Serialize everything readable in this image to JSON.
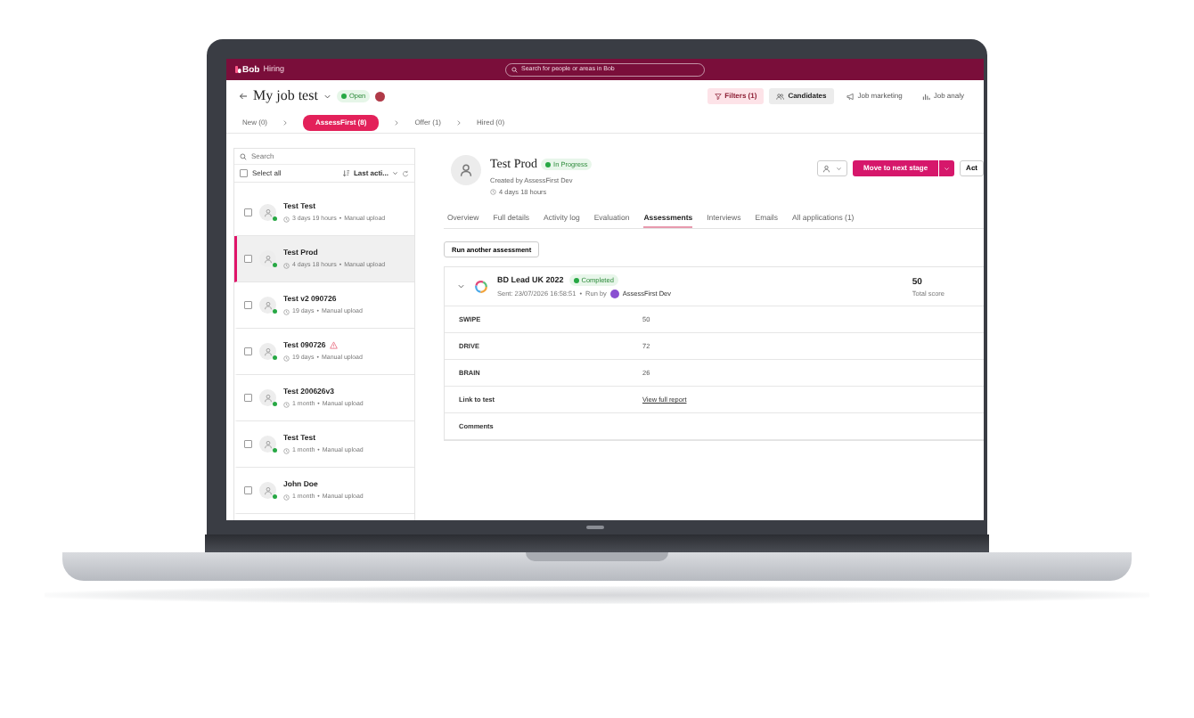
{
  "app": {
    "logo": "Bob",
    "section": "Hiring",
    "search_placeholder": "Search for people or areas in Bob"
  },
  "job": {
    "title": "My job test",
    "status": "Open"
  },
  "filters_button": "Filters (1)",
  "view_tabs": [
    {
      "label": "Candidates",
      "selected": true
    },
    {
      "label": "Job marketing",
      "selected": false
    },
    {
      "label": "Job analy",
      "selected": false
    }
  ],
  "stages": [
    {
      "label": "New (0)",
      "selected": false
    },
    {
      "label": "AssessFirst (8)",
      "selected": true
    },
    {
      "label": "Offer (1)",
      "selected": false
    },
    {
      "label": "Hired (0)",
      "selected": false
    }
  ],
  "candidate_list": {
    "search_placeholder": "Search",
    "select_all": {
      "label": "Select all",
      "checked": false
    },
    "sort": "Last acti...",
    "candidates": [
      {
        "name": "Test Test",
        "time": "3 days 19 hours",
        "separator": "•",
        "source": "Manual upload",
        "selected": false,
        "checked": false,
        "warning": false
      },
      {
        "name": "Test Prod",
        "time": "4 days 18 hours",
        "separator": "•",
        "source": "Manual upload",
        "selected": true,
        "checked": false,
        "warning": false
      },
      {
        "name": "Test v2 090726",
        "time": "19 days",
        "separator": "•",
        "source": "Manual upload",
        "selected": false,
        "checked": false,
        "warning": false
      },
      {
        "name": "Test 090726",
        "time": "19 days",
        "separator": "•",
        "source": "Manual upload",
        "selected": false,
        "checked": false,
        "warning": true
      },
      {
        "name": "Test 200626v3",
        "time": "1 month",
        "separator": "•",
        "source": "Manual upload",
        "selected": false,
        "checked": false,
        "warning": false
      },
      {
        "name": "Test Test",
        "time": "1 month",
        "separator": "•",
        "source": "Manual upload",
        "selected": false,
        "checked": false,
        "warning": false
      },
      {
        "name": "John Doe",
        "time": "1 month",
        "separator": "•",
        "source": "Manual upload",
        "selected": false,
        "checked": false,
        "warning": false
      }
    ]
  },
  "candidate": {
    "name": "Test Prod",
    "status": "In Progress",
    "created": "Created by AssessFirst Dev",
    "time": "4 days 18 hours",
    "primary_button": "Move to next stage",
    "secondary_button": "Act"
  },
  "tabs": [
    {
      "label": "Overview",
      "selected": false
    },
    {
      "label": "Full details",
      "selected": false
    },
    {
      "label": "Activity log",
      "selected": false
    },
    {
      "label": "Evaluation",
      "selected": false
    },
    {
      "label": "Assessments",
      "selected": true
    },
    {
      "label": "Interviews",
      "selected": false
    },
    {
      "label": "Emails",
      "selected": false
    },
    {
      "label": "All applications (1)",
      "selected": false
    }
  ],
  "run_button": "Run another assessment",
  "assessment": {
    "title": "BD Lead UK 2022",
    "status": "Completed",
    "sent": "Sent: 23/07/2026 16:58:51",
    "separator": "•",
    "run_by": "Run by",
    "runner": "AssessFirst Dev",
    "score": "50",
    "score_label": "Total score",
    "rows": [
      {
        "label": "SWIPE",
        "value": "50",
        "kind": "text"
      },
      {
        "label": "DRIVE",
        "value": "72",
        "kind": "text"
      },
      {
        "label": "BRAIN",
        "value": "26",
        "kind": "text"
      },
      {
        "label": "Link to test",
        "value": "View full report",
        "kind": "link"
      },
      {
        "label": "Comments",
        "kind": "empty"
      }
    ]
  }
}
